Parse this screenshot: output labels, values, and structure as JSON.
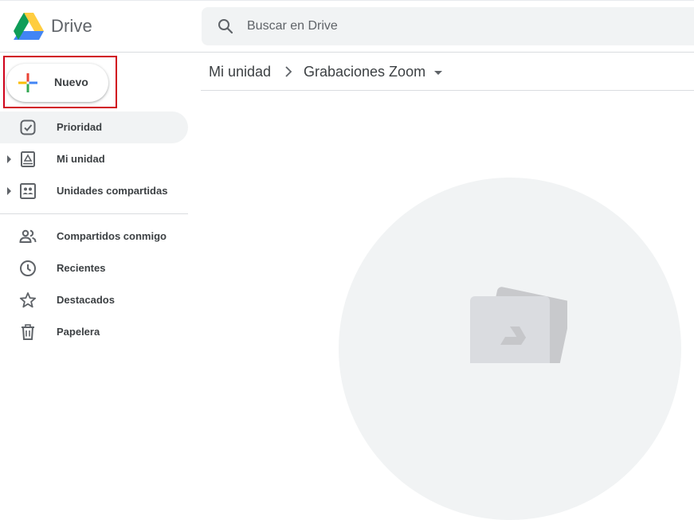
{
  "header": {
    "app_name": "Drive",
    "search_placeholder": "Buscar en Drive"
  },
  "sidebar": {
    "new_button_label": "Nuevo",
    "items": [
      {
        "label": "Prioridad",
        "icon": "priority-icon",
        "active": true
      },
      {
        "label": "Mi unidad",
        "icon": "my-drive-icon",
        "expandable": true
      },
      {
        "label": "Unidades compartidas",
        "icon": "shared-drives-icon",
        "expandable": true
      },
      {
        "label": "Compartidos conmigo",
        "icon": "shared-with-me-icon"
      },
      {
        "label": "Recientes",
        "icon": "clock-icon"
      },
      {
        "label": "Destacados",
        "icon": "star-icon"
      },
      {
        "label": "Papelera",
        "icon": "trash-icon"
      }
    ]
  },
  "breadcrumb": {
    "root": "Mi unidad",
    "current": "Grabaciones Zoom"
  },
  "colors": {
    "highlight": "#d0021b",
    "active_bg": "#f1f3f4",
    "icon": "#5f6368"
  }
}
